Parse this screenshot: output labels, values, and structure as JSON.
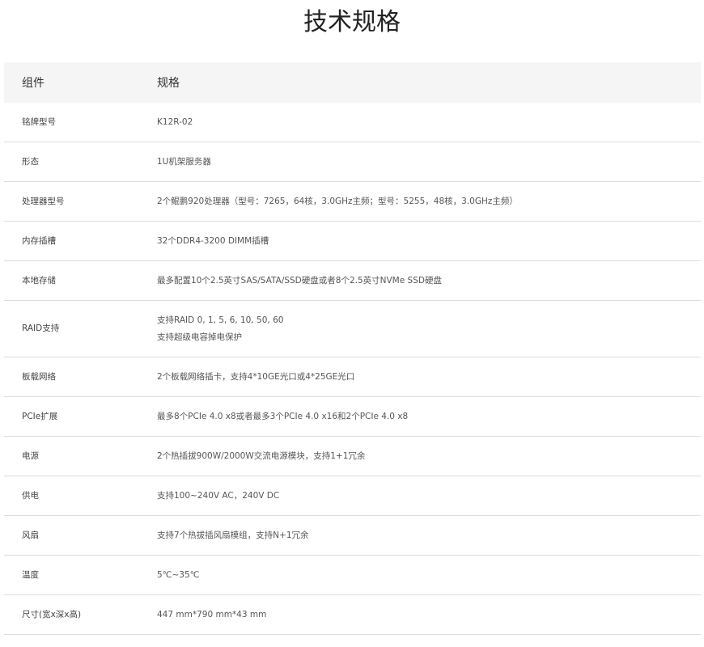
{
  "title": "技术规格",
  "table": {
    "headers": [
      "组件",
      "规格"
    ],
    "rows": [
      {
        "label": "铭牌型号",
        "values": [
          "K12R-02"
        ]
      },
      {
        "label": "形态",
        "values": [
          "1U机架服务器"
        ]
      },
      {
        "label": "处理器型号",
        "values": [
          "2个鲲鹏920处理器（型号：7265，64核，3.0GHz主频；型号：5255，48核，3.0GHz主频）"
        ]
      },
      {
        "label": "内存插槽",
        "values": [
          "32个DDR4-3200 DIMM插槽"
        ]
      },
      {
        "label": "本地存储",
        "values": [
          "最多配置10个2.5英寸SAS/SATA/SSD硬盘或者8个2.5英寸NVMe SSD硬盘"
        ]
      },
      {
        "label": "RAID支持",
        "values": [
          "支持RAID 0, 1, 5, 6, 10, 50, 60",
          "支持超级电容掉电保护"
        ]
      },
      {
        "label": "板载网络",
        "values": [
          "2个板载网络插卡，支持4*10GE光口或4*25GE光口"
        ]
      },
      {
        "label": "PCIe扩展",
        "values": [
          "最多8个PCIe 4.0 x8或者最多3个PCIe 4.0 x16和2个PCIe 4.0 x8"
        ]
      },
      {
        "label": "电源",
        "values": [
          "2个热插拔900W/2000W交流电源模块，支持1+1冗余"
        ]
      },
      {
        "label": "供电",
        "values": [
          "支持100~240V AC，240V DC"
        ]
      },
      {
        "label": "风扇",
        "values": [
          "支持7个热拔插风扇模组，支持N+1冗余"
        ]
      },
      {
        "label": "温度",
        "values": [
          "5℃~35℃"
        ]
      },
      {
        "label": "尺寸(宽x深x高)",
        "values": [
          "447 mm*790 mm*43 mm"
        ]
      }
    ]
  },
  "colors": {
    "header_bg": "#f5f5f5",
    "row_border": "#dddddd",
    "text": "#555555"
  }
}
